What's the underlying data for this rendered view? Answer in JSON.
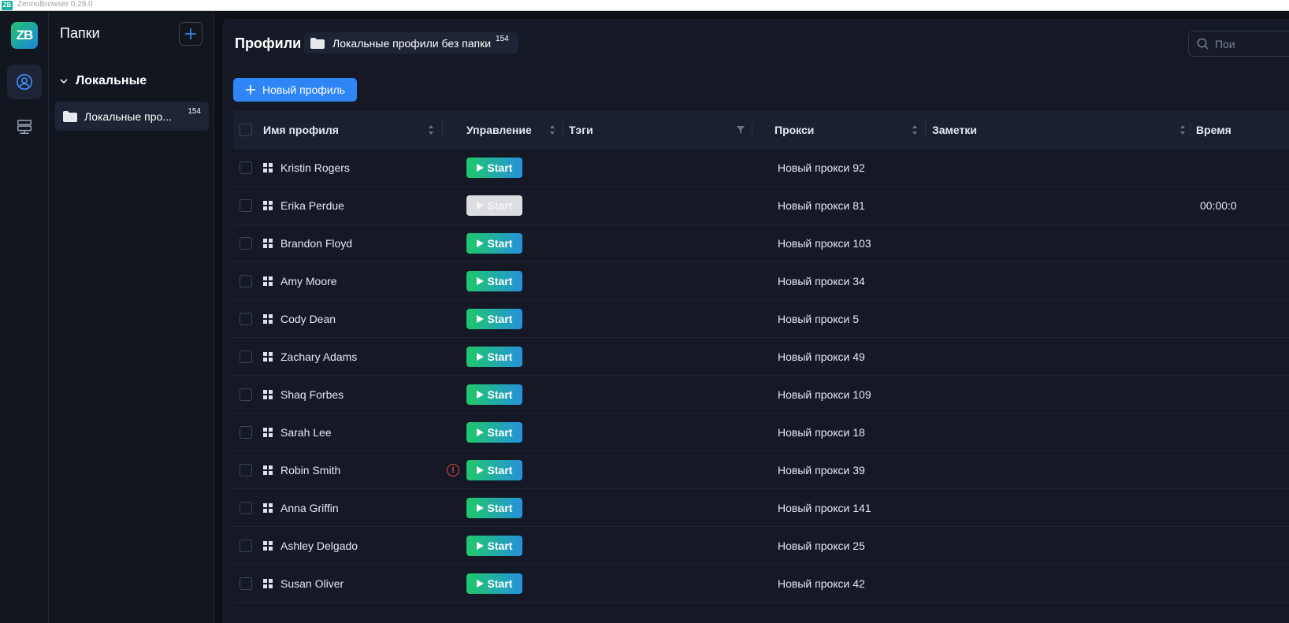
{
  "window": {
    "title": "ZennoBrowser 0.29.0",
    "icon_text": "ZB"
  },
  "rail": {
    "logo_text": "ZB",
    "items": [
      "profiles-icon",
      "proxies-icon"
    ]
  },
  "folders": {
    "title": "Папки",
    "group_label": "Локальные",
    "items": [
      {
        "label": "Локальные про...",
        "count": "154"
      }
    ]
  },
  "header": {
    "title": "Профили",
    "breadcrumb_label": "Локальные профили без папки",
    "breadcrumb_count": "154",
    "search_placeholder": "Пои"
  },
  "toolbar": {
    "new_profile_label": "Новый профиль"
  },
  "table": {
    "columns": {
      "name": "Имя профиля",
      "control": "Управление",
      "tags": "Тэги",
      "proxy": "Прокси",
      "notes": "Заметки",
      "time": "Время"
    },
    "start_label": "Start",
    "rows": [
      {
        "name": "Kristin Rogers",
        "proxy": "Новый прокси 92",
        "time": "",
        "disabled": false,
        "warning": false
      },
      {
        "name": "Erika Perdue",
        "proxy": "Новый прокси 81",
        "time": "00:00:0",
        "disabled": true,
        "warning": false
      },
      {
        "name": "Brandon Floyd",
        "proxy": "Новый прокси 103",
        "time": "",
        "disabled": false,
        "warning": false
      },
      {
        "name": "Amy Moore",
        "proxy": "Новый прокси 34",
        "time": "",
        "disabled": false,
        "warning": false
      },
      {
        "name": "Cody Dean",
        "proxy": "Новый прокси 5",
        "time": "",
        "disabled": false,
        "warning": false
      },
      {
        "name": "Zachary Adams",
        "proxy": "Новый прокси 49",
        "time": "",
        "disabled": false,
        "warning": false
      },
      {
        "name": "Shaq Forbes",
        "proxy": "Новый прокси 109",
        "time": "",
        "disabled": false,
        "warning": false
      },
      {
        "name": "Sarah Lee",
        "proxy": "Новый прокси 18",
        "time": "",
        "disabled": false,
        "warning": false
      },
      {
        "name": "Robin Smith",
        "proxy": "Новый прокси 39",
        "time": "",
        "disabled": false,
        "warning": true
      },
      {
        "name": "Anna Griffin",
        "proxy": "Новый прокси 141",
        "time": "",
        "disabled": false,
        "warning": false
      },
      {
        "name": "Ashley Delgado",
        "proxy": "Новый прокси 25",
        "time": "",
        "disabled": false,
        "warning": false
      },
      {
        "name": "Susan Oliver",
        "proxy": "Новый прокси 42",
        "time": "",
        "disabled": false,
        "warning": false
      }
    ]
  },
  "colors": {
    "accent": "#2f85f5",
    "start_from": "#1fc86a",
    "start_to": "#2592db",
    "warning": "#e04646",
    "background": "#141925"
  }
}
